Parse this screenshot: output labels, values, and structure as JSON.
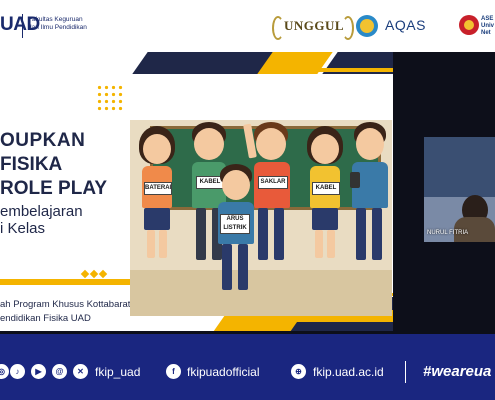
{
  "header": {
    "uad_logo_text": "UAD",
    "faculty_line1": "Fakultas Keguruan",
    "faculty_line2": "dan Ilmu Pendidikan",
    "unggul_label": "UNGGUL",
    "aqas_label": "AQAS",
    "asean_line1": "ASE",
    "asean_line2": "Univ",
    "asean_line3": "Net"
  },
  "slide": {
    "title_line1": "OUPKAN",
    "title_line2": "FISIKA",
    "title_line3": "ROLE PLAY",
    "subtitle_line1": "embelajaran",
    "subtitle_line2": "i Kelas",
    "footer_line1": "ah Program Khusus Kottabarat Surakarta",
    "footer_line2": "endidikan Fisika UAD",
    "illustration_signs": [
      "BATERAI",
      "KABEL",
      "SAKLAR",
      "KABEL",
      "ARUS LISTRIK"
    ]
  },
  "video": {
    "participant_name": "NURUL FITRIA"
  },
  "footer": {
    "instagram_handle": "fkip_uad",
    "facebook_handle": "fkipuadofficial",
    "website": "fkip.uad.ac.id",
    "hashtag": "#weareua"
  },
  "colors": {
    "navy": "#1f2748",
    "accent_yellow": "#f4b400",
    "footer_blue": "#1a2680"
  }
}
